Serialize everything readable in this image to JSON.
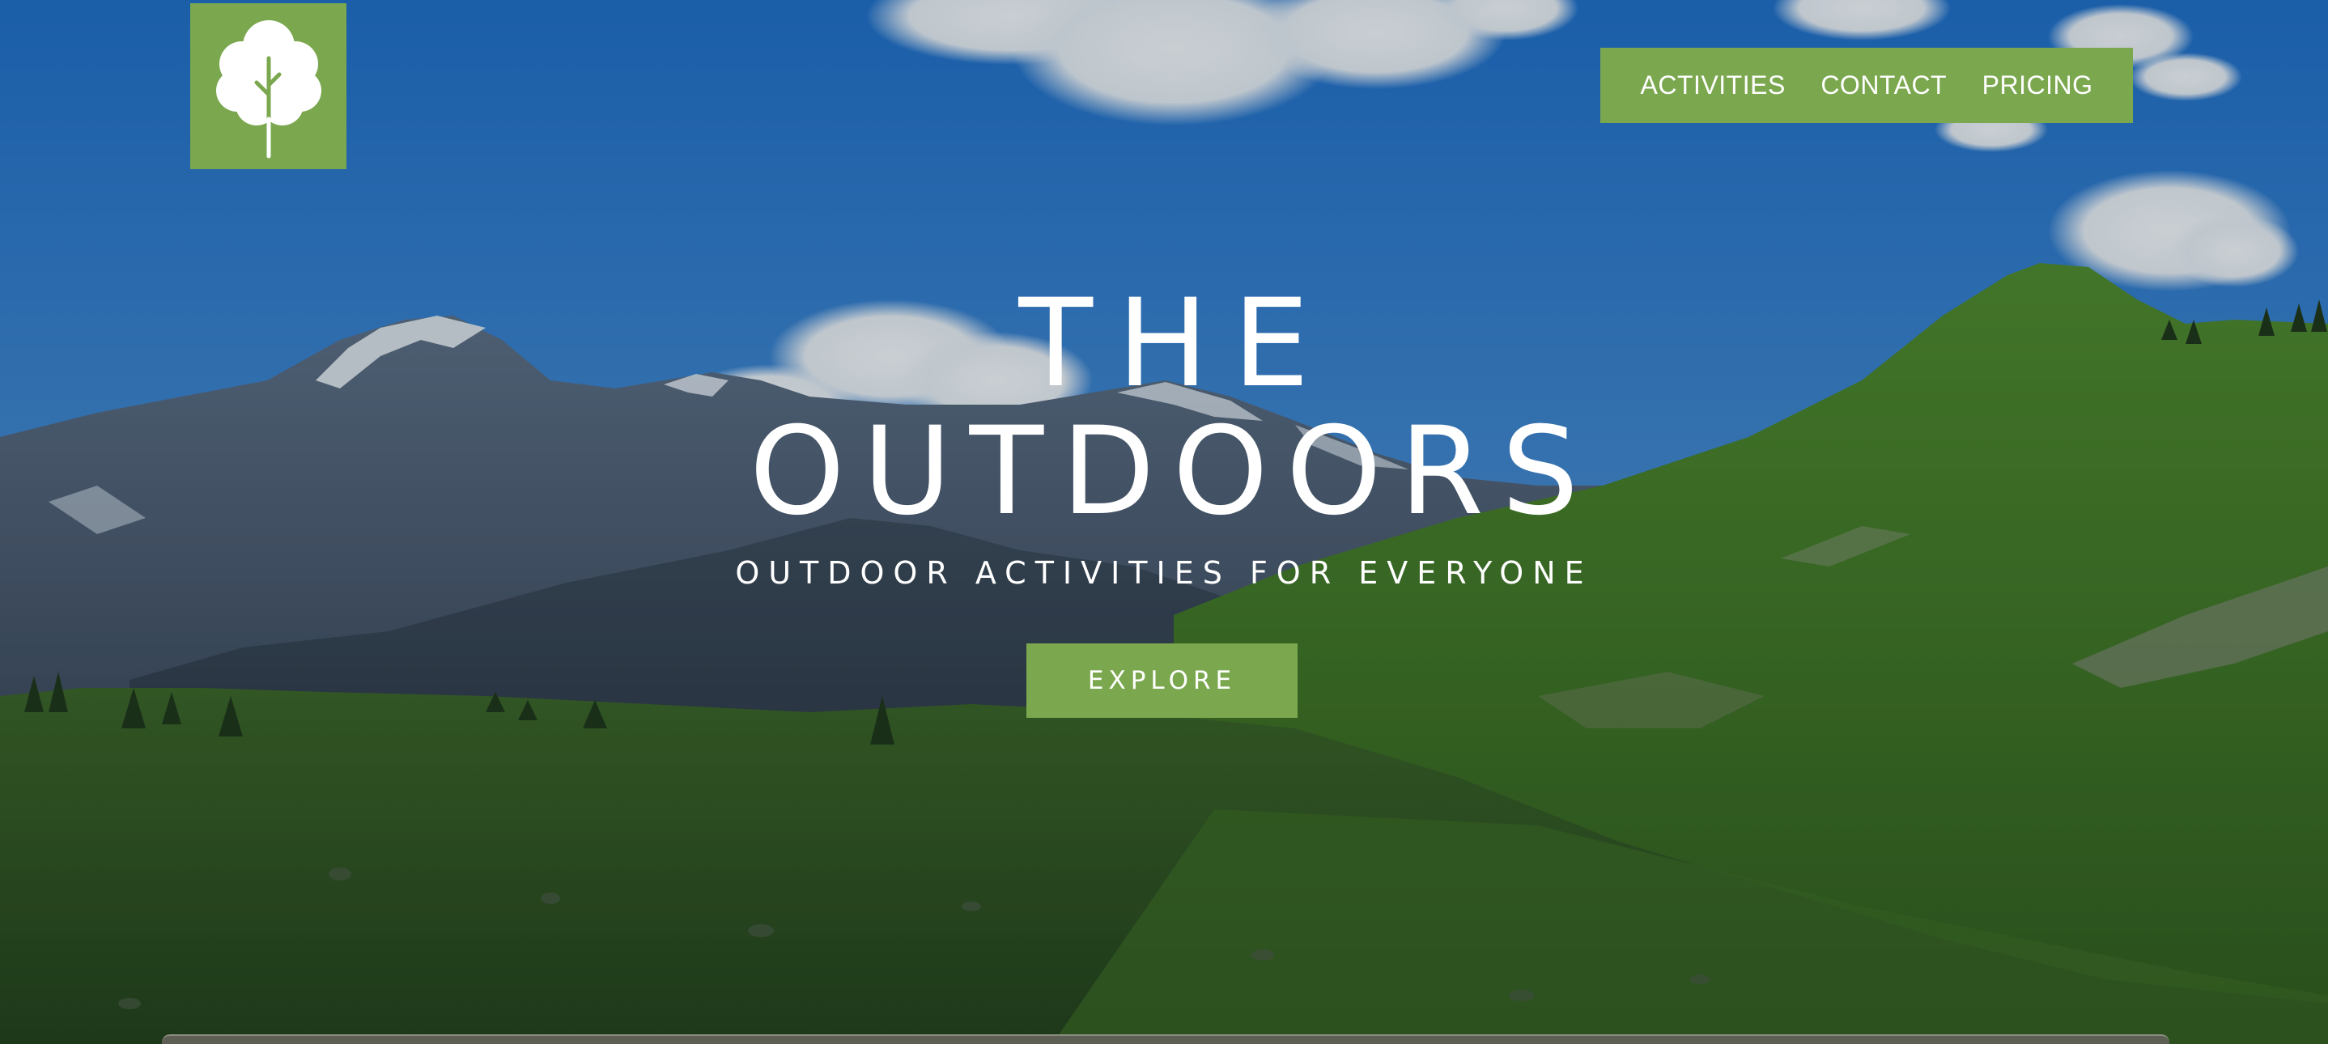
{
  "nav": {
    "items": [
      {
        "label": "ACTIVITIES"
      },
      {
        "label": "CONTACT"
      },
      {
        "label": "PRICING"
      }
    ]
  },
  "hero": {
    "title_line1": "THE",
    "title_line2": "OUTDOORS",
    "subtitle": "OUTDOOR ACTIVITIES FOR EVERYONE",
    "cta_label": "EXPLORE"
  },
  "logo": {
    "icon": "tree-icon"
  },
  "colors": {
    "accent": "#7ba84f",
    "text": "#ffffff",
    "sky": "#2f7fd0",
    "grass": "#4e7d2c"
  }
}
